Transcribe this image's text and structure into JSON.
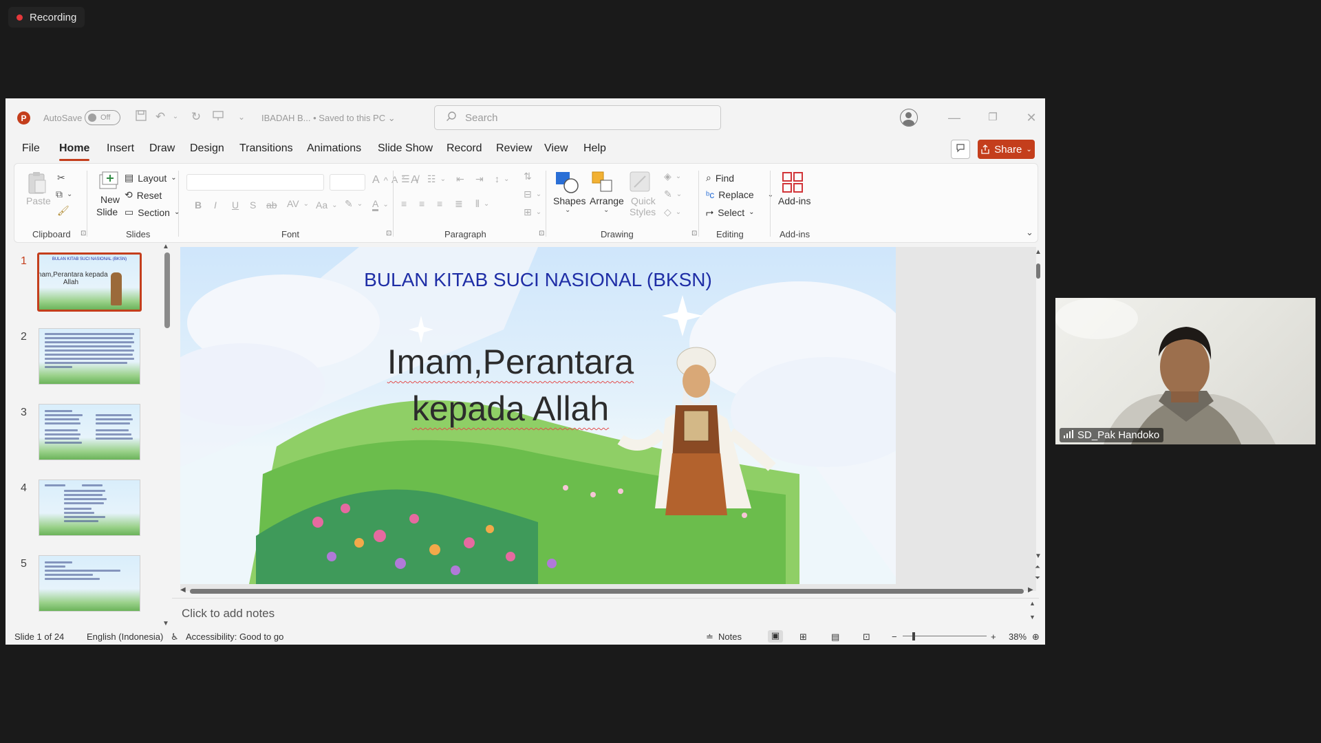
{
  "recording": {
    "label": "Recording"
  },
  "titlebar": {
    "autosave_label": "AutoSave",
    "autosave_state": "Off",
    "doc_title": "IBADAH B... • Saved to this PC ⌄",
    "search_placeholder": "Search"
  },
  "menu": {
    "items": [
      "File",
      "Home",
      "Insert",
      "Draw",
      "Design",
      "Transitions",
      "Animations",
      "Slide Show",
      "Record",
      "Review",
      "View",
      "Help"
    ],
    "share_label": "Share"
  },
  "ribbon": {
    "clipboard": {
      "label": "Clipboard",
      "paste": "Paste"
    },
    "slides": {
      "label": "Slides",
      "new_slide": "New",
      "new_slide2": "Slide",
      "layout": "Layout",
      "reset": "Reset",
      "section": "Section"
    },
    "font": {
      "label": "Font"
    },
    "paragraph": {
      "label": "Paragraph"
    },
    "drawing": {
      "label": "Drawing",
      "shapes": "Shapes",
      "arrange": "Arrange",
      "quick_styles": "Quick",
      "quick_styles2": "Styles"
    },
    "editing": {
      "label": "Editing",
      "find": "Find",
      "replace": "Replace",
      "select": "Select"
    },
    "addins": {
      "label": "Add-ins",
      "button": "Add-ins"
    }
  },
  "thumbnails": [
    {
      "num": "1",
      "title": "BULAN KITAB SUCI NASIONAL (BKSN)",
      "sub": "Imam,Perantara kepada Allah"
    },
    {
      "num": "2"
    },
    {
      "num": "3"
    },
    {
      "num": "4"
    },
    {
      "num": "5"
    }
  ],
  "slide": {
    "title": "BULAN KITAB SUCI NASIONAL (BKSN)",
    "line1": "Imam,Perantara",
    "line2": "kepada Allah"
  },
  "notes": {
    "placeholder": "Click to add notes"
  },
  "status": {
    "slide_count": "Slide 1 of 24",
    "language": "English (Indonesia)",
    "accessibility": "Accessibility: Good to go",
    "notes": "Notes",
    "zoom": "38%"
  },
  "camera": {
    "name": "SD_Pak Handoko"
  }
}
